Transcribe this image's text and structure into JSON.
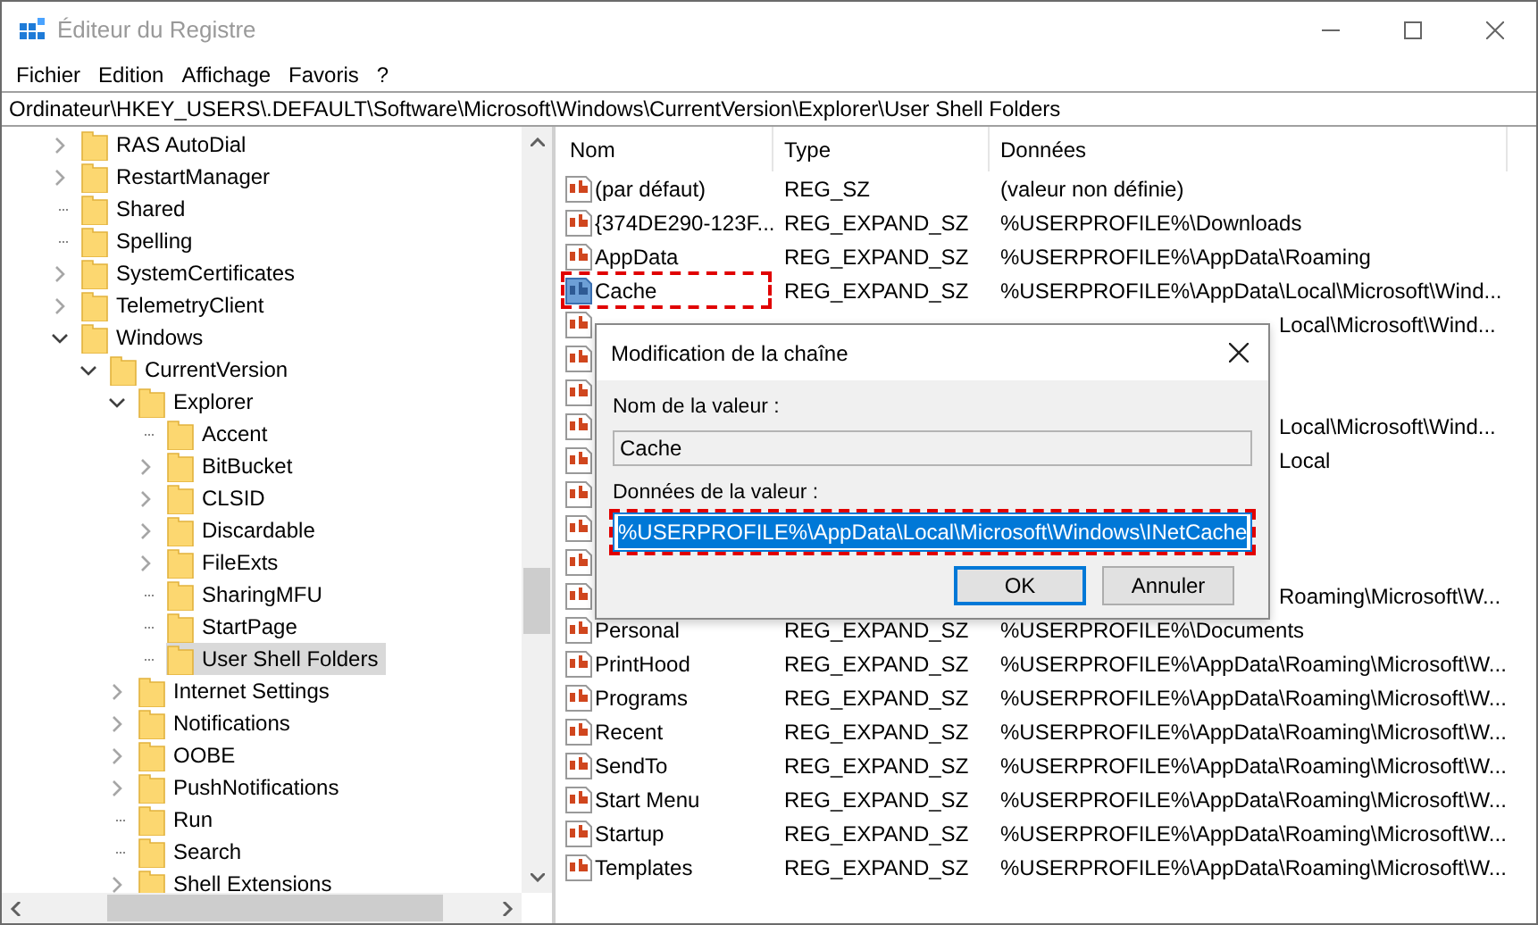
{
  "window": {
    "title": "Éditeur du Registre"
  },
  "menu": [
    "Fichier",
    "Edition",
    "Affichage",
    "Favoris",
    "?"
  ],
  "address": "Ordinateur\\HKEY_USERS\\.DEFAULT\\Software\\Microsoft\\Windows\\CurrentVersion\\Explorer\\User Shell Folders",
  "tree": [
    {
      "label": "RAS AutoDial",
      "has_children": true,
      "expanded": false,
      "selected": false
    },
    {
      "label": "RestartManager",
      "has_children": true,
      "expanded": false,
      "selected": false
    },
    {
      "label": "Shared",
      "has_children": false,
      "selected": false
    },
    {
      "label": "Spelling",
      "has_children": false,
      "selected": false
    },
    {
      "label": "SystemCertificates",
      "has_children": true,
      "expanded": false,
      "selected": false
    },
    {
      "label": "TelemetryClient",
      "has_children": true,
      "expanded": false,
      "selected": false
    },
    {
      "label": "Windows",
      "has_children": true,
      "expanded": true,
      "selected": false,
      "children": [
        {
          "label": "CurrentVersion",
          "has_children": true,
          "expanded": true,
          "selected": false,
          "children": [
            {
              "label": "Explorer",
              "has_children": true,
              "expanded": true,
              "selected": false,
              "children": [
                {
                  "label": "Accent",
                  "has_children": false,
                  "selected": false
                },
                {
                  "label": "BitBucket",
                  "has_children": true,
                  "expanded": false,
                  "selected": false
                },
                {
                  "label": "CLSID",
                  "has_children": true,
                  "expanded": false,
                  "selected": false
                },
                {
                  "label": "Discardable",
                  "has_children": true,
                  "expanded": false,
                  "selected": false
                },
                {
                  "label": "FileExts",
                  "has_children": true,
                  "expanded": false,
                  "selected": false
                },
                {
                  "label": "SharingMFU",
                  "has_children": false,
                  "selected": false
                },
                {
                  "label": "StartPage",
                  "has_children": false,
                  "selected": false
                },
                {
                  "label": "User Shell Folders",
                  "has_children": false,
                  "selected": true
                }
              ]
            },
            {
              "label": "Internet Settings",
              "has_children": true,
              "expanded": false,
              "selected": false
            },
            {
              "label": "Notifications",
              "has_children": true,
              "expanded": false,
              "selected": false
            },
            {
              "label": "OOBE",
              "has_children": true,
              "expanded": false,
              "selected": false
            },
            {
              "label": "PushNotifications",
              "has_children": true,
              "expanded": false,
              "selected": false
            },
            {
              "label": "Run",
              "has_children": false,
              "selected": false
            },
            {
              "label": "Search",
              "has_children": false,
              "selected": false
            },
            {
              "label": "Shell Extensions",
              "has_children": true,
              "expanded": false,
              "selected": false
            }
          ]
        }
      ]
    }
  ],
  "table": {
    "columns": [
      "Nom",
      "Type",
      "Données"
    ],
    "rows": [
      {
        "name": "(par défaut)",
        "type": "REG_SZ",
        "data": "(valeur non définie)",
        "selected": false,
        "highlighted": false
      },
      {
        "name": "{374DE290-123F...",
        "type": "REG_EXPAND_SZ",
        "data": "%USERPROFILE%\\Downloads",
        "selected": false,
        "highlighted": false
      },
      {
        "name": "AppData",
        "type": "REG_EXPAND_SZ",
        "data": "%USERPROFILE%\\AppData\\Roaming",
        "selected": false,
        "highlighted": false
      },
      {
        "name": "Cache",
        "type": "REG_EXPAND_SZ",
        "data": "%USERPROFILE%\\AppData\\Local\\Microsoft\\Wind...",
        "selected": true,
        "highlighted": true
      },
      {
        "data_tail": "Local\\Microsoft\\Wind..."
      },
      {},
      {},
      {
        "data_tail": "Local\\Microsoft\\Wind..."
      },
      {
        "data_tail": "Local"
      },
      {},
      {},
      {},
      {
        "data_tail": "Roaming\\Microsoft\\W..."
      },
      {
        "name": "Personal",
        "type": "REG_EXPAND_SZ",
        "data": "%USERPROFILE%\\Documents",
        "selected": false,
        "highlighted": false
      },
      {
        "name": "PrintHood",
        "type": "REG_EXPAND_SZ",
        "data": "%USERPROFILE%\\AppData\\Roaming\\Microsoft\\W...",
        "selected": false,
        "highlighted": false
      },
      {
        "name": "Programs",
        "type": "REG_EXPAND_SZ",
        "data": "%USERPROFILE%\\AppData\\Roaming\\Microsoft\\W...",
        "selected": false,
        "highlighted": false
      },
      {
        "name": "Recent",
        "type": "REG_EXPAND_SZ",
        "data": "%USERPROFILE%\\AppData\\Roaming\\Microsoft\\W...",
        "selected": false,
        "highlighted": false
      },
      {
        "name": "SendTo",
        "type": "REG_EXPAND_SZ",
        "data": "%USERPROFILE%\\AppData\\Roaming\\Microsoft\\W...",
        "selected": false,
        "highlighted": false
      },
      {
        "name": "Start Menu",
        "type": "REG_EXPAND_SZ",
        "data": "%USERPROFILE%\\AppData\\Roaming\\Microsoft\\W...",
        "selected": false,
        "highlighted": false
      },
      {
        "name": "Startup",
        "type": "REG_EXPAND_SZ",
        "data": "%USERPROFILE%\\AppData\\Roaming\\Microsoft\\W...",
        "selected": false,
        "highlighted": false
      },
      {
        "name": "Templates",
        "type": "REG_EXPAND_SZ",
        "data": "%USERPROFILE%\\AppData\\Roaming\\Microsoft\\W...",
        "selected": false,
        "highlighted": false
      }
    ]
  },
  "dialog": {
    "title": "Modification de la chaîne",
    "name_label": "Nom de la valeur :",
    "name_value": "Cache",
    "data_label": "Données de la valeur :",
    "data_value": "%USERPROFILE%\\AppData\\Local\\Microsoft\\Windows\\INetCache",
    "data_text_selected": true,
    "data_highlighted": true,
    "buttons": [
      {
        "label": "OK",
        "kind": "default"
      },
      {
        "label": "Annuler",
        "kind": "normal"
      }
    ]
  }
}
